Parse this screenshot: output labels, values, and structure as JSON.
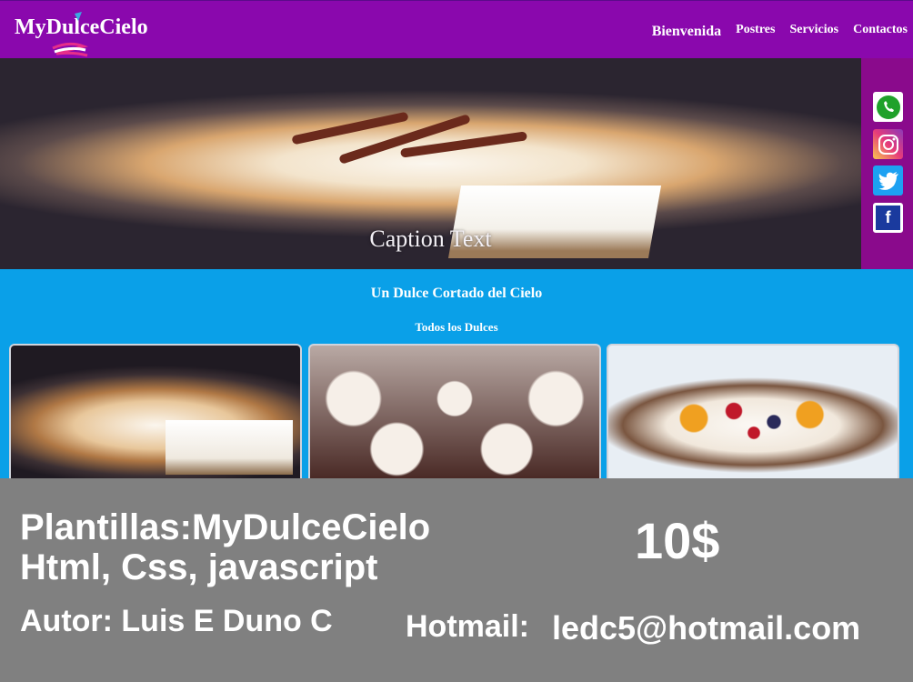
{
  "header": {
    "logo": "MyDulceCielo",
    "nav": [
      {
        "label": "Bienvenida",
        "active": true
      },
      {
        "label": "Postres"
      },
      {
        "label": "Servicios"
      },
      {
        "label": "Contactos"
      }
    ]
  },
  "hero": {
    "caption": "Caption Text"
  },
  "social": [
    {
      "icon": "whatsapp-icon",
      "color": "#1fa12a"
    },
    {
      "icon": "instagram-icon",
      "color": "#c13584"
    },
    {
      "icon": "twitter-icon",
      "color": "#1da1f2"
    },
    {
      "icon": "facebook-icon",
      "color": "#1a3a9e"
    }
  ],
  "section": {
    "title": "Un Dulce Cortado del Cielo",
    "subtitle": "Todos los Dulces"
  },
  "promo": {
    "line1": "Plantillas:MyDulceCielo",
    "line2": "Html, Css, javascript",
    "price": "10$",
    "author": "Autor: Luis E Duno C",
    "mail_label": "Hotmail:",
    "mail": "ledc5@hotmail.com"
  },
  "colors": {
    "header": "#8a08ad",
    "section": "#0aa0e8",
    "promo": "#808080"
  }
}
